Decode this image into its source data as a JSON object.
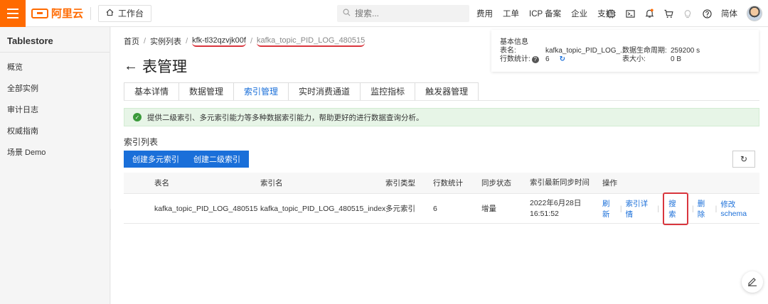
{
  "brand": {
    "logo_text": "阿里云",
    "color": "#ff6a00"
  },
  "topbar": {
    "workbench_label": "工作台",
    "search_placeholder": "搜索...",
    "nav": [
      "费用",
      "工单",
      "ICP 备案",
      "企业",
      "支持"
    ],
    "lang": "简体"
  },
  "sidebar": {
    "title": "Tablestore",
    "items": [
      {
        "label": "概览"
      },
      {
        "label": "全部实例"
      },
      {
        "label": "审计日志"
      },
      {
        "label": "权威指南"
      },
      {
        "label": "场景 Demo"
      }
    ]
  },
  "breadcrumb": {
    "home": "首页",
    "instances": "实例列表",
    "instance": "kfk-tl32qzvjk00f",
    "table": "kafka_topic_PID_LOG_480515"
  },
  "page": {
    "title": "表管理"
  },
  "info": {
    "heading": "基本信息",
    "table_name_label": "表名:",
    "table_name": "kafka_topic_PID_LOG_...",
    "ttl_label": "数据生命周期:",
    "ttl": "259200 s",
    "row_count_label": "行数统计:",
    "row_count": "6",
    "table_size_label": "表大小:",
    "table_size": "0 B"
  },
  "tabs": [
    {
      "label": "基本详情",
      "active": false
    },
    {
      "label": "数据管理",
      "active": false
    },
    {
      "label": "索引管理",
      "active": true
    },
    {
      "label": "实时消费通道",
      "active": false
    },
    {
      "label": "监控指标",
      "active": false
    },
    {
      "label": "触发器管理",
      "active": false
    }
  ],
  "notice": {
    "text": "提供二级索引、多元索引能力等多种数据索引能力，帮助更好的进行数据查询分析。"
  },
  "index_list": {
    "title": "索引列表",
    "create_search_index": "创建多元索引",
    "create_secondary_index": "创建二级索引",
    "columns": [
      "表名",
      "索引名",
      "索引类型",
      "行数统计",
      "同步状态",
      "索引最新同步时间",
      "操作"
    ],
    "rows": [
      {
        "table": "kafka_topic_PID_LOG_480515",
        "index": "kafka_topic_PID_LOG_480515_index",
        "type": "多元索引",
        "rows": "6",
        "sync": "增量",
        "sync_date": "2022年6月28日",
        "sync_time": "16:51:52",
        "actions": [
          "刷新",
          "索引详情",
          "搜索",
          "删除",
          "修改schema"
        ]
      }
    ]
  },
  "colors": {
    "primary": "#1a6fd9",
    "highlight": "#d9363e",
    "success_bg": "#e7f5e7"
  }
}
